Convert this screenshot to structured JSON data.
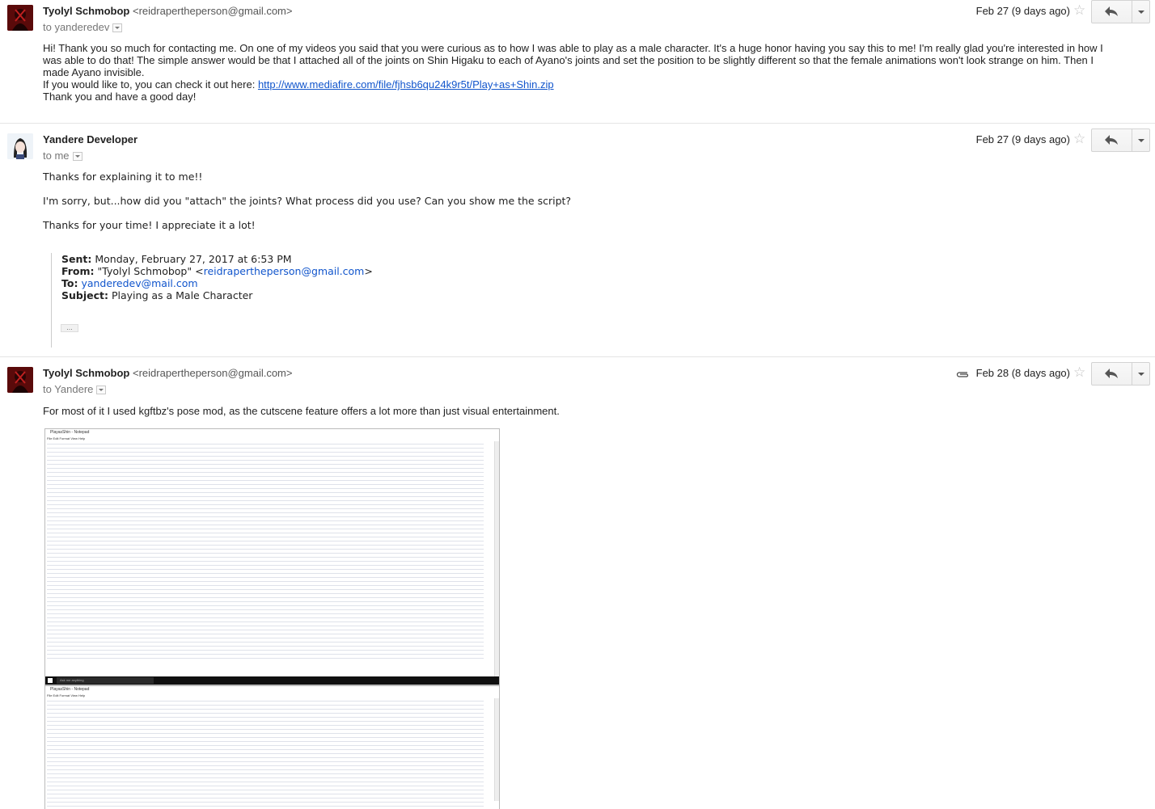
{
  "messages": [
    {
      "sender_name": "Tyolyl Schmobop",
      "sender_email": "<reidrapertheperson@gmail.com>",
      "to_line": "to yanderedev",
      "date": "Feb 27 (9 days ago)",
      "paragraph1": "Hi! Thank you so much for contacting me. On one of my videos you said that you were curious as to how I was able to play as a male character. It's a huge honor having you say this to me! I'm really glad you're interested in how I was able to do that! The simple answer would be that I attached all of the joints on Shin Higaku to each of Ayano's joints and set the position to be slightly different so that the female animations won't look strange on him. Then I made Ayano invisible.",
      "link_prefix": "If you would like to, you can check it out here: ",
      "link": "http://www.mediafire.com/file/fjhsb6qu24k9r5t/Play+as+Shin.zip",
      "closing": "Thank you and have a good day!"
    },
    {
      "sender_name": "Yandere Developer",
      "to_line": "to me",
      "date": "Feb 27 (9 days ago)",
      "line1": "Thanks for explaining it to me!!",
      "line2": "I'm sorry, but...how did you \"attach\" the joints? What process did you use? Can you show me the script?",
      "line3": "Thanks for your time! I appreciate it a lot!",
      "quote": {
        "sent_label": "Sent:",
        "sent_value": "Monday, February 27, 2017 at 6:53 PM",
        "from_label": "From:",
        "from_name": "\"Tyolyl Schmobop\" <",
        "from_email": "reidrapertheperson@gmail.com",
        "from_close": ">",
        "to_label": "To:",
        "to_email": "yanderedev@mail.com",
        "subject_label": "Subject:",
        "subject_value": "Playing as a Male Character",
        "ellipsis": "..."
      }
    },
    {
      "sender_name": "Tyolyl Schmobop",
      "sender_email": "<reidrapertheperson@gmail.com>",
      "to_line": "to Yandere",
      "date": "Feb 28 (8 days ago)",
      "body": "For most of it I used kgftbz's pose mod, as the cutscene feature offers a lot more than just visual entertainment.",
      "screenshot1": {
        "title": "PlayasShin - Notepad",
        "menu": "File   Edit   Format   View   Help",
        "taskbar_search": "Ask me anything"
      },
      "screenshot2": {
        "title": "PlayasShin - Notepad",
        "menu": "File   Edit   Format   View   Help"
      }
    }
  ],
  "icons": {
    "star": "star-icon",
    "reply": "reply-icon",
    "more": "more-options-icon",
    "attachment": "paperclip-icon"
  },
  "colors": {
    "link": "#1155cc",
    "separator": "#e5e5e5"
  }
}
